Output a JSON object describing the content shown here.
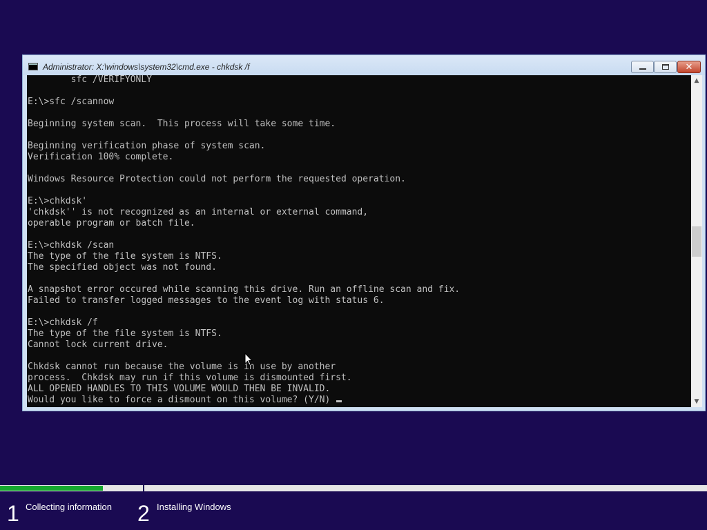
{
  "window": {
    "title": "Administrator: X:\\windows\\system32\\cmd.exe - chkdsk  /f",
    "icon": "console-icon",
    "controls": [
      "minimize",
      "maximize",
      "close"
    ]
  },
  "console": {
    "lines": [
      "        sfc /VERIFYONLY",
      "",
      "E:\\>sfc /scannow",
      "",
      "Beginning system scan.  This process will take some time.",
      "",
      "Beginning verification phase of system scan.",
      "Verification 100% complete.",
      "",
      "Windows Resource Protection could not perform the requested operation.",
      "",
      "E:\\>chkdsk'",
      "'chkdsk'' is not recognized as an internal or external command,",
      "operable program or batch file.",
      "",
      "E:\\>chkdsk /scan",
      "The type of the file system is NTFS.",
      "The specified object was not found.",
      "",
      "A snapshot error occured while scanning this drive. Run an offline scan and fix.",
      "Failed to transfer logged messages to the event log with status 6.",
      "",
      "E:\\>chkdsk /f",
      "The type of the file system is NTFS.",
      "Cannot lock current drive.",
      "",
      "Chkdsk cannot run because the volume is in use by another",
      "process.  Chkdsk may run if this volume is dismounted first.",
      "ALL OPENED HANDLES TO THIS VOLUME WOULD THEN BE INVALID.",
      "Would you like to force a dismount on this volume? (Y/N) "
    ],
    "colors": {
      "background": "#0c0c0c",
      "text": "#c0c0c0"
    }
  },
  "setup": {
    "progress": {
      "step1_fraction": 0.72,
      "step2_fraction": 0.0,
      "fill_color": "#17a82f"
    },
    "steps": [
      {
        "number": "1",
        "label": "Collecting information"
      },
      {
        "number": "2",
        "label": "Installing Windows"
      }
    ]
  },
  "colors": {
    "desktop_background": "#1a0a52"
  }
}
